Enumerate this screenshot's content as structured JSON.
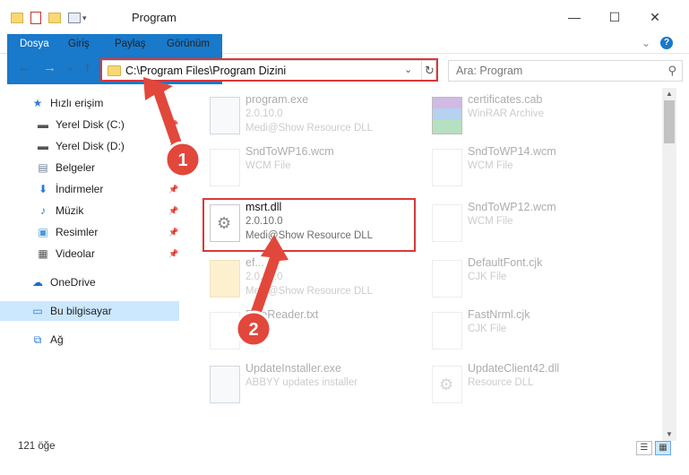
{
  "window": {
    "title": "Program",
    "minimize_glyph": "—",
    "maximize_glyph": "☐",
    "close_glyph": "✕"
  },
  "ribbon": {
    "tabs": [
      "Dosya",
      "Giriş",
      "Paylaş",
      "Görünüm"
    ],
    "expand_glyph": "⌄",
    "help_glyph": "?"
  },
  "nav": {
    "back_glyph": "←",
    "forward_glyph": "→",
    "recent_glyph": "⌄",
    "up_glyph": "↑",
    "address": "C:\\Program Files\\Program Dizini",
    "address_dropdown_glyph": "⌄",
    "refresh_glyph": "↻",
    "search_placeholder": "Ara: Program",
    "search_glyph": "⚲"
  },
  "sidebar": {
    "items": [
      {
        "label": "Hızlı erişim",
        "icon": "star-icon",
        "glyph": "★",
        "color": "#3a7bd5",
        "pinned": false
      },
      {
        "label": "Yerel Disk (C:)",
        "icon": "drive-icon",
        "glyph": "▬",
        "color": "#555555",
        "pinned": true
      },
      {
        "label": "Yerel Disk (D:)",
        "icon": "drive-icon",
        "glyph": "▬",
        "color": "#555555",
        "pinned": true
      },
      {
        "label": "Belgeler",
        "icon": "documents-icon",
        "glyph": "▤",
        "color": "#6d7f99",
        "pinned": true
      },
      {
        "label": "İndirmeler",
        "icon": "download-icon",
        "glyph": "⬇",
        "color": "#2a78d6",
        "pinned": true
      },
      {
        "label": "Müzik",
        "icon": "music-icon",
        "glyph": "♪",
        "color": "#2a78d6",
        "pinned": true
      },
      {
        "label": "Resimler",
        "icon": "pictures-icon",
        "glyph": "▣",
        "color": "#4a9bd9",
        "pinned": true
      },
      {
        "label": "Videolar",
        "icon": "videos-icon",
        "glyph": "▦",
        "color": "#555555",
        "pinned": true
      },
      {
        "label": "OneDrive",
        "icon": "cloud-icon",
        "glyph": "☁",
        "color": "#1b6fc9",
        "pinned": false
      },
      {
        "label": "Bu bilgisayar",
        "icon": "computer-icon",
        "glyph": "▭",
        "color": "#2a78d6",
        "pinned": false
      },
      {
        "label": "Ağ",
        "icon": "network-icon",
        "glyph": "⧉",
        "color": "#2a78d6",
        "pinned": false
      }
    ],
    "pin_glyph": "📌"
  },
  "files": [
    {
      "name": "program.exe",
      "line1": "2.0.10.0",
      "line2": "Medi@Show Resource DLL",
      "kind": "exe",
      "faded": true
    },
    {
      "name": "certificates.cab",
      "line1": "WinRAR Archive",
      "line2": "",
      "kind": "arch",
      "faded": true
    },
    {
      "name": "SndToWP16.wcm",
      "line1": "WCM File",
      "line2": "",
      "kind": "doc",
      "faded": true
    },
    {
      "name": "SndToWP14.wcm",
      "line1": "WCM File",
      "line2": "",
      "kind": "doc",
      "faded": true
    },
    {
      "name": "msrt.dll",
      "line1": "2.0.10.0",
      "line2": "Medi@Show Resource DLL",
      "kind": "dll",
      "faded": false
    },
    {
      "name": "SndToWP12.wcm",
      "line1": "WCM File",
      "line2": "",
      "kind": "doc",
      "faded": true
    },
    {
      "name": "ef...",
      "line1": "2.0.10.0",
      "line2": "Medi@Show Resource DLL",
      "kind": "folder",
      "faded": true
    },
    {
      "name": "DefaultFont.cjk",
      "line1": "CJK File",
      "line2": "",
      "kind": "doc",
      "faded": true
    },
    {
      "name": "FineReader.txt",
      "line1": "...ile",
      "line2": "",
      "kind": "doc",
      "faded": true
    },
    {
      "name": "FastNrml.cjk",
      "line1": "CJK File",
      "line2": "",
      "kind": "doc",
      "faded": true
    },
    {
      "name": "UpdateInstaller.exe",
      "line1": "ABBYY updates installer",
      "line2": "",
      "kind": "exe",
      "faded": true
    },
    {
      "name": "UpdateClient42.dll",
      "line1": "Resource DLL",
      "line2": "",
      "kind": "dll",
      "faded": true
    }
  ],
  "callouts": [
    "1",
    "2"
  ],
  "status": {
    "item_count": "121 öğe",
    "details_view_glyph": "☰",
    "tiles_view_glyph": "▦"
  },
  "colors": {
    "accent": "#1979ca",
    "highlight_red": "#d9383a",
    "selected_nav": "#cce8ff"
  }
}
